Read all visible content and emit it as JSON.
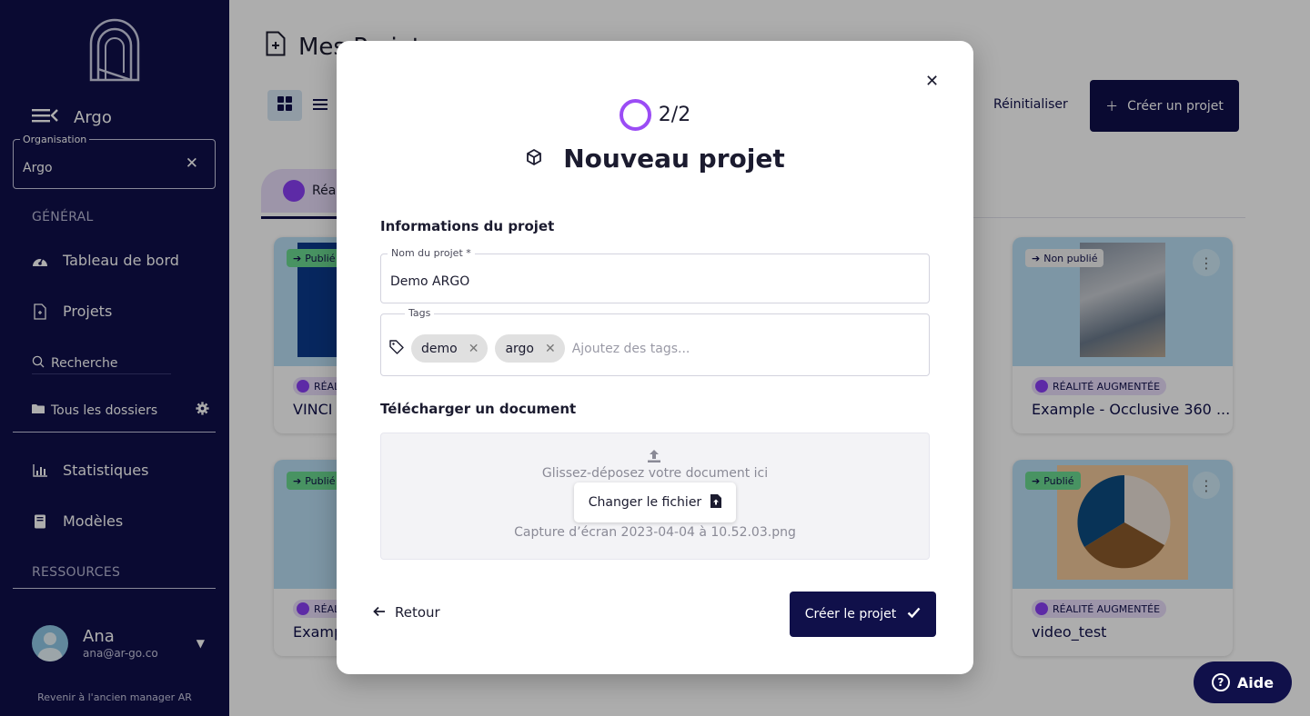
{
  "sidebar": {
    "brand": "Argo",
    "organisation": {
      "label": "Organisation",
      "value": "Argo"
    },
    "general_title": "GÉNÉRAL",
    "nav": [
      {
        "label": "Tableau de bord",
        "icon": "gauge-icon"
      },
      {
        "label": "Projets",
        "icon": "file-icon"
      }
    ],
    "search_label": "Recherche",
    "folders_label": "Tous les dossiers",
    "nav2": [
      {
        "label": "Statistiques",
        "icon": "chart-icon"
      },
      {
        "label": "Modèles",
        "icon": "book-icon"
      }
    ],
    "resources_title": "RESSOURCES",
    "user": {
      "name": "Ana",
      "email": "ana@ar-go.co"
    },
    "old_manager": "Revenir à l'ancien manager AR"
  },
  "main": {
    "title": "Mes Projets",
    "reset_label": "Réinitialiser",
    "create_label": "Créer un projet",
    "tab_label": "Réal",
    "cards": [
      {
        "status": "Publié",
        "kind": "RÉALI",
        "name": "VINCI ("
      },
      {
        "status": "Non publié",
        "kind": "RÉALITÉ AUGMENTÉE",
        "name": "Example - Occlusive 360 ..."
      },
      {
        "status": "Publié",
        "kind": "RÉALI",
        "name": "Examp"
      },
      {
        "status": "Publié",
        "kind": "RÉALITÉ AUGMENTÉE",
        "name": "video_test"
      }
    ]
  },
  "modal": {
    "step": "2/2",
    "title": "Nouveau projet",
    "info_section": "Informations du projet",
    "name_label": "Nom du projet *",
    "name_value": "Demo ARGO",
    "tags_label": "Tags",
    "tags": [
      "demo",
      "argo"
    ],
    "tags_placeholder": "Ajoutez des tags...",
    "upload_section": "Télécharger un document",
    "dropzone_hint": "Glissez-déposez votre document ici",
    "change_file_label": "Changer le fichier",
    "file_name": "Capture d’écran 2023-04-04 à 10.52.03.png",
    "back_label": "Retour",
    "submit_label": "Créer le projet"
  },
  "help_label": "Aide",
  "colors": {
    "navy": "#10104a",
    "accent_purple": "#9b4cf5",
    "published_green": "#6bd991"
  }
}
